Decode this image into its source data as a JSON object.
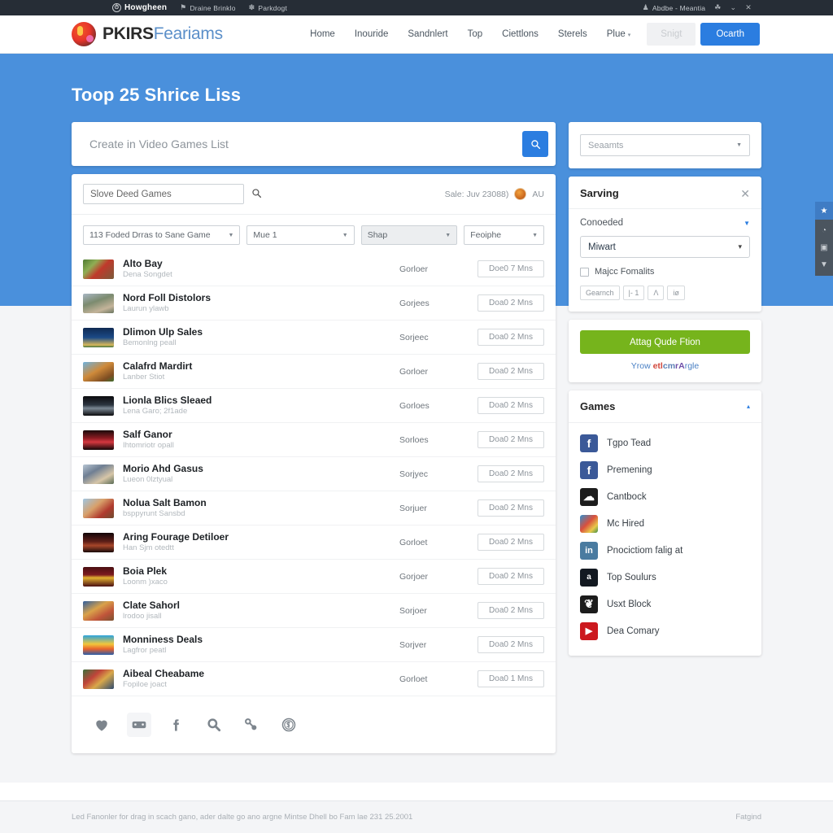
{
  "topbar": {
    "brand": "Howgheen",
    "items": [
      {
        "label": "Draine Brinklo",
        "icon": "flag-icon"
      },
      {
        "label": "Parkdogt",
        "icon": "feather-icon"
      }
    ],
    "right": [
      {
        "label": "Abdbe - Meantia",
        "icon": "user-icon"
      },
      {
        "label": "",
        "icon": "balloon-icon"
      },
      {
        "label": "",
        "icon": "download-icon"
      },
      {
        "label": "",
        "icon": "close-icon"
      }
    ]
  },
  "header": {
    "logo_bold": "PKIRS",
    "logo_light": "Feariams",
    "nav": [
      {
        "label": "Home"
      },
      {
        "label": "Inouride"
      },
      {
        "label": "Sandnlert"
      },
      {
        "label": "Top"
      },
      {
        "label": "Ciettlons"
      },
      {
        "label": "Sterels"
      },
      {
        "label": "Plue",
        "caret": "▾"
      }
    ],
    "ghost_button": "Snigt",
    "primary_button": "Ocarth"
  },
  "hero": {
    "title": "Toop 25 Shrice Liss",
    "search_placeholder": "Create in Video Games List",
    "search_value": "",
    "search_icon": "search-icon"
  },
  "list_card": {
    "filter_search_value": "Slove Deed Games",
    "filter_search_icon": "search-icon",
    "meta_text": "Sale: Juv 23088)",
    "meta_avatar_label": "AU",
    "selects": [
      {
        "label": "113 Foded Drras to Sane Game",
        "width": "w1"
      },
      {
        "label": "Mue 1",
        "width": "w2"
      },
      {
        "label": "Shap",
        "width": "w3"
      },
      {
        "label": "Feoiphe",
        "width": "w4"
      }
    ],
    "rows": [
      {
        "title": "Alto Bay",
        "sub": "Dena Songdet",
        "mid": "Gorloer",
        "button": "Doe0 7 Mns",
        "thumb": "linear-gradient(135deg,#4e7a32 0%,#8fae54 30%,#c0392b 55%,#7a5b3a 100%)"
      },
      {
        "title": "Nord Foll Distolors",
        "sub": "Laurun ylawb",
        "mid": "Gorjees",
        "button": "Doa0 2 Mns",
        "thumb": "linear-gradient(160deg,#a9b7c4 0%,#7c8b6f 40%,#c4b49a 75%,#6a7560 100%)"
      },
      {
        "title": "Dlimon Ulp Sales",
        "sub": "Bemonlng peall",
        "mid": "Sorjeec",
        "button": "Doa0 2 Mns",
        "thumb": "linear-gradient(180deg,#102a52 0%,#1b4a86 50%,#d8b85a 88%,#3a6f3a 100%)"
      },
      {
        "title": "Calafrd Mardirt",
        "sub": "Lanber Stiot",
        "mid": "Gorloer",
        "button": "Doa0 2 Mns",
        "thumb": "linear-gradient(150deg,#6fb2dd 0%,#cf8a3a 45%,#7e4d22 80%,#3f6d2e 100%)"
      },
      {
        "title": "Lionla Blics Sleaed",
        "sub": "Lena Garo; 2f1ade",
        "mid": "Gorloes",
        "button": "Doa0 2 Mns",
        "thumb": "linear-gradient(180deg,#0b0b0d 0%,#2c3540 45%,#7b8894 62%,#0b0b0d 100%)"
      },
      {
        "title": "Salf Ganor",
        "sub": "Ihtomriotr opall",
        "mid": "Sorloes",
        "button": "Doa0 2 Mns",
        "thumb": "linear-gradient(180deg,#1a0b0b 0%,#8c1b22 40%,#d4383f 60%,#120607 100%)"
      },
      {
        "title": "Morio Ahd Gasus",
        "sub": "Lueon 0lztyual",
        "mid": "Sorjyec",
        "button": "Doa0 2 Mns",
        "thumb": "linear-gradient(150deg,#b8c6d4 0%,#6f7f93 35%,#d7c6a8 70%,#5a6b55 100%)"
      },
      {
        "title": "Nolua Salt Bamon",
        "sub": "bsppyrunt Sansbd",
        "mid": "Sorjuer",
        "button": "Doa0 2 Mns",
        "thumb": "linear-gradient(140deg,#9ec6e4 0%,#d8a06a 40%,#b03a2e 70%,#6d4c2f 100%)"
      },
      {
        "title": "Aring Fourage Detiloer",
        "sub": "Han Sjm otedtt",
        "mid": "Gorloet",
        "button": "Doa0 2 Mns",
        "thumb": "linear-gradient(180deg,#120508 0%,#5e1f18 45%,#a8472a 65%,#1a0a0a 100%)"
      },
      {
        "title": "Boia Plek",
        "sub": "Loonm )xaco",
        "mid": "Gorjoer",
        "button": "Doa0 2 Mns",
        "thumb": "linear-gradient(180deg,#4a0f12 0%,#7d1b1e 40%,#e3b230 55%,#4a0f12 100%)"
      },
      {
        "title": "Clate Sahorl",
        "sub": "lrodoo jisall",
        "mid": "Sorjoer",
        "button": "Doa0 2 Mns",
        "thumb": "linear-gradient(150deg,#2f5e9e 0%,#d9a24a 40%,#c0553a 70%,#7a5230 100%)"
      },
      {
        "title": "Monniness Deals",
        "sub": "Lagfror peatl",
        "mid": "Sorjver",
        "button": "Doa0 2 Mns",
        "thumb": "linear-gradient(180deg,#2aa4de 0%,#f2c63a 45%,#e8622c 70%,#2a5ea8 100%)"
      },
      {
        "title": "Aibeal Cheabame",
        "sub": "Fopiloe joact",
        "mid": "Gorloet",
        "button": "Doa0 1 Mns",
        "thumb": "linear-gradient(140deg,#3c6f3a 0%,#c0443a 35%,#d9a84a 60%,#2e4a6e 100%)"
      }
    ],
    "icon_bar": [
      {
        "name": "heart-icon",
        "boxed": false
      },
      {
        "name": "gamepad-icon",
        "boxed": true
      },
      {
        "name": "facebook-f-icon",
        "boxed": false
      },
      {
        "name": "search-icon",
        "boxed": false
      },
      {
        "name": "link-icon",
        "boxed": false
      },
      {
        "name": "coin-icon",
        "boxed": false
      }
    ]
  },
  "sidebar": {
    "top_select": "Seaamts",
    "panel": {
      "title": "Sarving",
      "close_icon": "close-icon",
      "row_label": "Conoeded",
      "input_value": "Miwart",
      "checkbox_label": "Majcc Fomalits",
      "chips": [
        "Gearnch",
        "|- 1",
        "Λ",
        "iø"
      ]
    },
    "cta": {
      "button": "Attag Qude Ftion",
      "sub_parts": [
        {
          "text": "Yrow ",
          "cls": "a"
        },
        {
          "text": "etl",
          "cls": "b"
        },
        {
          "text": "cm",
          "cls": "c"
        },
        {
          "text": "rA",
          "cls": "d"
        },
        {
          "text": "rgle",
          "cls": "a"
        }
      ]
    },
    "games": {
      "title": "Games",
      "chevron": "▴",
      "items": [
        {
          "label": "Tgpo Tead",
          "icon": "facebook-icon",
          "bg": "#3b5998",
          "glyph": "f"
        },
        {
          "label": "Premening",
          "icon": "facebook-icon",
          "bg": "#3b5998",
          "glyph": "f"
        },
        {
          "label": "Cantbock",
          "icon": "cloud-icon",
          "bg": "#1c1c1c",
          "glyph": "☁"
        },
        {
          "label": "Mc Hired",
          "icon": "photo-icon",
          "bg": "#5f8fbb",
          "glyph": "❖"
        },
        {
          "label": "Pnocictiom falig at",
          "icon": "linkedin-icon",
          "bg": "#4a7ba0",
          "glyph": "in"
        },
        {
          "label": "Top Soulurs",
          "icon": "amazon-icon",
          "bg": "#131921",
          "glyph": "a"
        },
        {
          "label": "Usxt Block",
          "icon": "twitter-icon",
          "bg": "#1c1c1c",
          "glyph": "❦"
        },
        {
          "label": "Dea Comary",
          "icon": "youtube-icon",
          "bg": "#cc181e",
          "glyph": "▶"
        }
      ]
    }
  },
  "dock": [
    {
      "icon": "star-icon",
      "glyph": "★",
      "accent": true
    },
    {
      "icon": "clock-icon",
      "glyph": "◔",
      "accent": false
    },
    {
      "icon": "save-icon",
      "glyph": "▣",
      "accent": false
    },
    {
      "icon": "comment-icon",
      "glyph": "▼",
      "accent": false
    }
  ],
  "footer": {
    "left": "Led Fanonler for drag in scach gano, ader dalte go ano argne Mintse Dhell bo Fam lae 231 25.2001",
    "right": "Fatgind"
  }
}
